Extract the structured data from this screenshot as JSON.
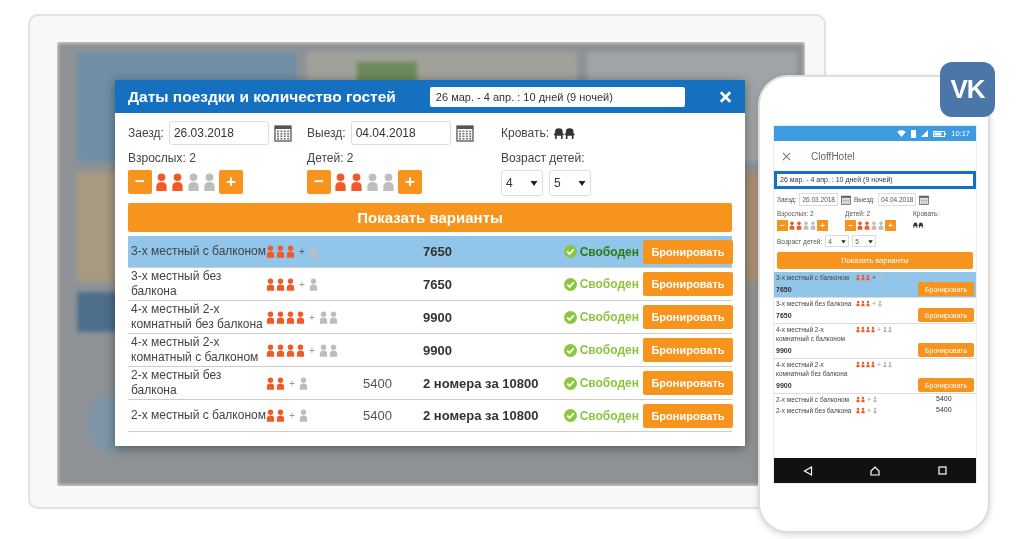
{
  "vk_logo": "VK",
  "desktop": {
    "title": "Даты поездки и количество гостей",
    "date_range": "26 мар. - 4 апр. : 10 дней (9 ночей)",
    "check_in": {
      "label": "Заезд:",
      "value": "26.03.2018"
    },
    "check_out": {
      "label": "Выезд:",
      "value": "04.04.2018"
    },
    "bed": {
      "label": "Кровать:"
    },
    "adults": {
      "label": "Взрослых:",
      "count": "2",
      "minus": "−",
      "plus": "+",
      "figures": [
        {
          "filled": true
        },
        {
          "filled": true
        },
        {
          "filled": false
        },
        {
          "filled": false
        }
      ]
    },
    "children": {
      "label": "Детей:",
      "count": "2",
      "minus": "−",
      "plus": "+",
      "figures": [
        {
          "filled": true
        },
        {
          "filled": true
        },
        {
          "filled": false
        },
        {
          "filled": false
        }
      ]
    },
    "child_ages": {
      "label": "Возраст детей:",
      "selects": [
        "4",
        "5"
      ]
    },
    "show_button": "Показать варианты",
    "rooms": [
      {
        "name": "3-х местный с балконом",
        "selected": true,
        "places": [
          {
            "kind": "main"
          },
          {
            "kind": "main"
          },
          {
            "kind": "main"
          },
          {
            "kind": "extra"
          }
        ],
        "plus": "+",
        "total": "7650",
        "status": "Свободен",
        "book": "Бронировать"
      },
      {
        "name": "3-х местный без балкона",
        "selected": false,
        "places": [
          {
            "kind": "main"
          },
          {
            "kind": "main"
          },
          {
            "kind": "main"
          },
          {
            "kind": "extra"
          }
        ],
        "plus": "+",
        "total": "7650",
        "status": "Свободен",
        "book": "Бронировать"
      },
      {
        "name": "4-х местный 2-х комнатный без балкона",
        "selected": false,
        "places": [
          {
            "kind": "main"
          },
          {
            "kind": "main"
          },
          {
            "kind": "main"
          },
          {
            "kind": "main"
          },
          {
            "kind": "extra"
          },
          {
            "kind": "extra"
          }
        ],
        "plus": "+",
        "total": "9900",
        "status": "Свободен",
        "book": "Бронировать"
      },
      {
        "name": "4-х местный 2-х комнатный с балконом",
        "selected": false,
        "places": [
          {
            "kind": "main"
          },
          {
            "kind": "main"
          },
          {
            "kind": "main"
          },
          {
            "kind": "main"
          },
          {
            "kind": "extra"
          },
          {
            "kind": "extra"
          }
        ],
        "plus": "+",
        "total": "9900",
        "status": "Свободен",
        "book": "Бронировать"
      },
      {
        "name": "2-х местный без балкона",
        "selected": false,
        "places": [
          {
            "kind": "main"
          },
          {
            "kind": "main"
          },
          {
            "kind": "extra"
          }
        ],
        "plus": "+",
        "price": "5400",
        "total": "2 номера за 10800",
        "status": "Свободен",
        "book": "Бронировать"
      },
      {
        "name": "2-х местный с балконом",
        "selected": false,
        "places": [
          {
            "kind": "main"
          },
          {
            "kind": "main"
          },
          {
            "kind": "extra"
          }
        ],
        "plus": "+",
        "price": "5400",
        "total": "2 номера за 10800",
        "status": "Свободен",
        "book": "Бронировать"
      }
    ]
  },
  "phone": {
    "time": "10:17",
    "app_title": "CloffHotel",
    "date_range": "26 мар. - 4 апр. : 10 дней (9 ночей)",
    "check_in": {
      "label": "Заезд:",
      "value": "26.03.2018"
    },
    "check_out": {
      "label": "Выезд:",
      "value": "04.04.2018"
    },
    "adults": {
      "label": "Взрослых: 2",
      "minus": "−",
      "plus": "+",
      "figures": [
        {
          "filled": true
        },
        {
          "filled": true
        },
        {
          "filled": false
        },
        {
          "filled": false
        }
      ]
    },
    "children": {
      "label": "Детей: 2",
      "minus": "−",
      "plus": "+",
      "figures": [
        {
          "filled": true
        },
        {
          "filled": true
        },
        {
          "filled": false
        },
        {
          "filled": false
        }
      ]
    },
    "bed": {
      "label": "Кровать:"
    },
    "child_ages": {
      "label": "Возраст детей:",
      "selects": [
        "4",
        "5"
      ]
    },
    "show_button": "Показать варианты",
    "rooms": [
      {
        "name": "3-х местный с балконом",
        "selected": true,
        "places": [
          {
            "kind": "main"
          },
          {
            "kind": "main"
          },
          {
            "kind": "main"
          },
          {
            "kind": "extra"
          }
        ],
        "plus": "+",
        "total": "7650",
        "book": "Бронировать"
      },
      {
        "name": "3-х местный без балкона",
        "selected": false,
        "places": [
          {
            "kind": "main"
          },
          {
            "kind": "main"
          },
          {
            "kind": "main"
          },
          {
            "kind": "extra"
          }
        ],
        "plus": "+",
        "total": "7650",
        "book": "Бронировать"
      },
      {
        "name": "4-х местный 2-х комнатный с балконом",
        "selected": false,
        "places": [
          {
            "kind": "main"
          },
          {
            "kind": "main"
          },
          {
            "kind": "main"
          },
          {
            "kind": "main"
          },
          {
            "kind": "extra"
          },
          {
            "kind": "extra"
          }
        ],
        "plus": "+",
        "total": "9900",
        "book": "Бронировать"
      },
      {
        "name": "4-х местный 2-х комнатный без балкона",
        "selected": false,
        "places": [
          {
            "kind": "main"
          },
          {
            "kind": "main"
          },
          {
            "kind": "main"
          },
          {
            "kind": "main"
          },
          {
            "kind": "extra"
          },
          {
            "kind": "extra"
          }
        ],
        "plus": "+",
        "total": "9900",
        "book": "Бронировать"
      },
      {
        "name": "2-х местный с балконом",
        "selected": false,
        "places": [
          {
            "kind": "main"
          },
          {
            "kind": "main"
          },
          {
            "kind": "extra"
          }
        ],
        "plus": "+",
        "price": "5400"
      },
      {
        "name": "2-х местный без балкона",
        "selected": false,
        "places": [
          {
            "kind": "main"
          },
          {
            "kind": "main"
          },
          {
            "kind": "extra"
          }
        ],
        "plus": "+",
        "price": "5400"
      }
    ]
  }
}
